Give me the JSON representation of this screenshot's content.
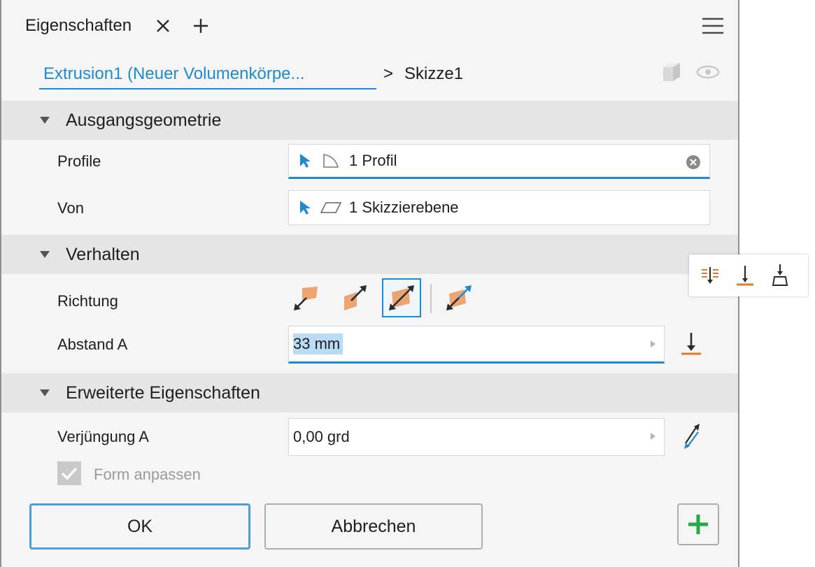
{
  "colors": {
    "accent": "#1d8ad1",
    "orange": "#e07a2e",
    "green": "#28a745",
    "panel_bg": "#f5f5f5",
    "section_bg": "#e5e5e5"
  },
  "tabs": [
    {
      "label": "Eigenschaften",
      "icon_close": "close-icon"
    }
  ],
  "tab_add_icon": "plus-icon",
  "menu_icon": "hamburger-menu-icon",
  "breadcrumb": {
    "parent": "Extrusion1 (Neuer Volumenkörpe...",
    "separator": ">",
    "current": "Skizze1",
    "icons": [
      "solid-body-icon",
      "eye-icon"
    ]
  },
  "sections": {
    "input_geometry": {
      "title": "Ausgangsgeometrie",
      "profile": {
        "label": "Profile",
        "value": "1 Profil",
        "icon": "profile-icon"
      },
      "from": {
        "label": "Von",
        "value": "1 Skizzierebene",
        "icon": "sketch-plane-icon"
      }
    },
    "behavior": {
      "title": "Verhalten",
      "direction": {
        "label": "Richtung",
        "options": [
          "direction-default-icon",
          "direction-flipped-icon",
          "direction-symmetric-icon",
          "direction-asymmetric-icon"
        ],
        "selected_index": 2
      },
      "distance": {
        "label": "Abstand A",
        "value": "33 mm"
      }
    },
    "advanced": {
      "title": "Erweiterte Eigenschaften",
      "taper": {
        "label": "Verjüngung A",
        "value": "0,00 grd"
      },
      "match_shape": {
        "label": "Form anpassen",
        "checked": true,
        "enabled": false
      }
    }
  },
  "buttons": {
    "ok": "OK",
    "cancel": "Abbrechen",
    "add": "plus-icon"
  },
  "flyout_icons": [
    "distance-extent-icon",
    "to-extent-icon",
    "to-next-icon"
  ]
}
